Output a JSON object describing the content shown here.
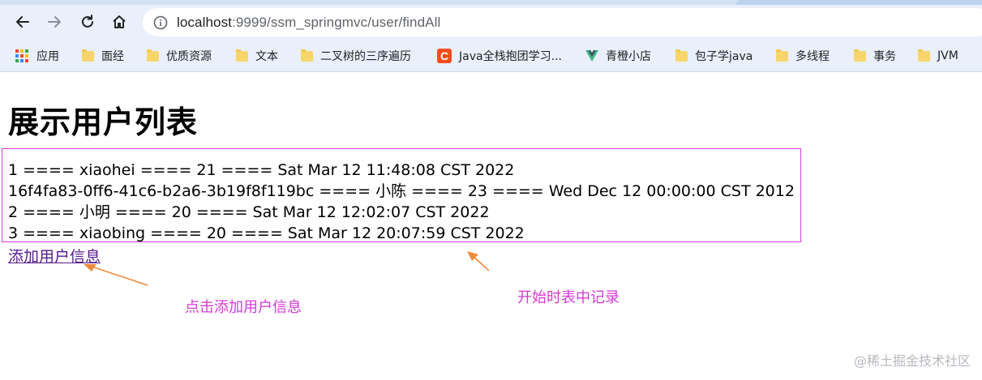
{
  "browser": {
    "url_host": "localhost",
    "url_rest": ":9999/ssm_springmvc/user/findAll"
  },
  "bookmarks": [
    {
      "label": "应用",
      "icon": "apps-grid-icon"
    },
    {
      "label": "面经",
      "icon": "folder-icon"
    },
    {
      "label": "优质资源",
      "icon": "folder-icon"
    },
    {
      "label": "文本",
      "icon": "folder-icon"
    },
    {
      "label": "二叉树的三序遍历",
      "icon": "folder-icon"
    },
    {
      "label": "Java全栈抱团学习...",
      "icon": "c-logo-icon"
    },
    {
      "label": "青橙小店",
      "icon": "vue-logo-icon"
    },
    {
      "label": "包子学java",
      "icon": "folder-icon"
    },
    {
      "label": "多线程",
      "icon": "folder-icon"
    },
    {
      "label": "事务",
      "icon": "folder-icon"
    },
    {
      "label": "JVM",
      "icon": "folder-icon"
    }
  ],
  "page": {
    "title": "展示用户列表",
    "records": [
      "1 ==== xiaohei ==== 21 ==== Sat Mar 12 11:48:08 CST 2022",
      "16f4fa83-0ff6-41c6-b2a6-3b19f8f119bc ==== 小陈 ==== 23 ==== Wed Dec 12 00:00:00 CST 2012",
      "2 ==== 小明 ==== 20 ==== Sat Mar 12 12:02:07 CST 2022",
      "3 ==== xiaobing ==== 20 ==== Sat Mar 12 20:07:59 CST 2022"
    ],
    "add_link": "添加用户信息"
  },
  "annotations": {
    "click_add_note": "点击添加用户信息",
    "initial_records_note": "开始时表中记录",
    "color": "#d63ad6",
    "arrow_color": "#ee8a3c"
  },
  "watermark": "@稀土掘金技术社区",
  "colors": {
    "chrome_bg": "#e9f0fb",
    "visited_link": "#551a8b"
  }
}
